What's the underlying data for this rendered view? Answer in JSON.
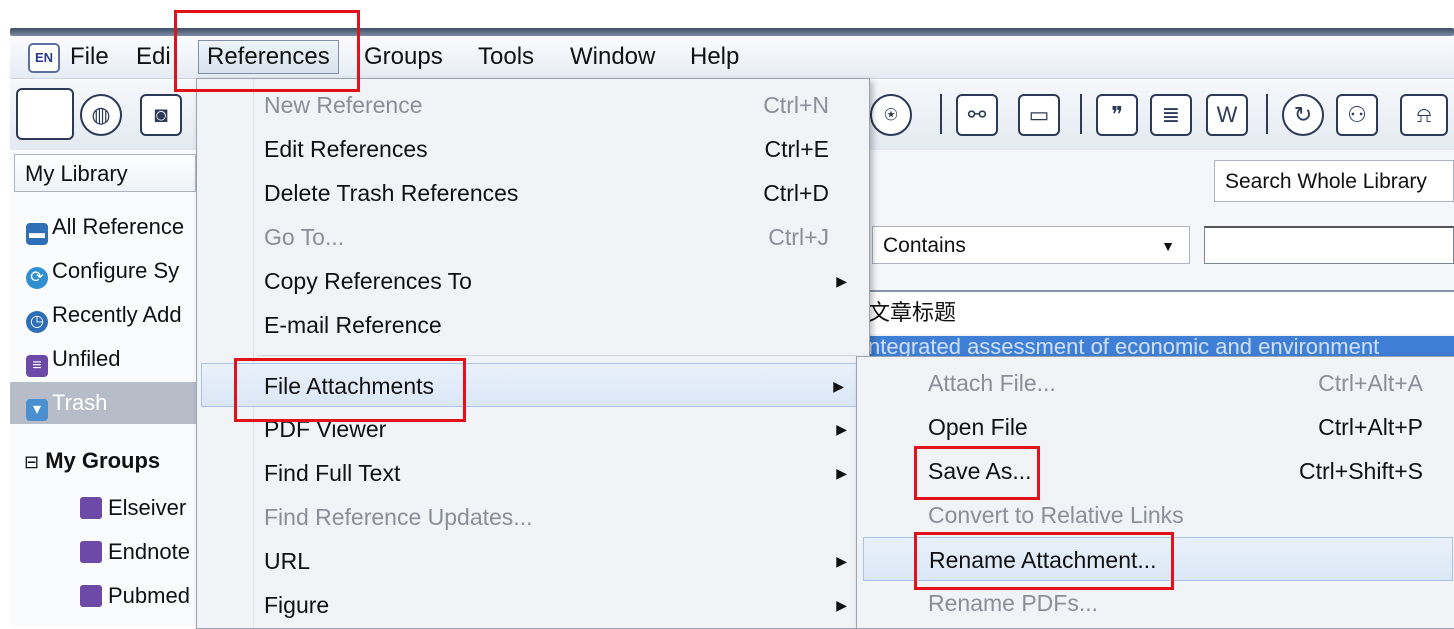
{
  "app_icon_label": "EN",
  "menubar": {
    "items": [
      "File",
      "Edi",
      "References",
      "Groups",
      "Tools",
      "Window",
      "Help"
    ]
  },
  "left_pane": {
    "library_dropdown": "My Library",
    "items": [
      {
        "label": "All Reference",
        "icon": "all-references-icon"
      },
      {
        "label": "Configure Sy",
        "icon": "sync-icon"
      },
      {
        "label": "Recently Add",
        "icon": "clock-icon"
      },
      {
        "label": "Unfiled",
        "icon": "unfiled-icon"
      },
      {
        "label": "Trash",
        "icon": "trash-icon"
      }
    ],
    "groups_toggle": "⊟",
    "groups_header": "My Groups",
    "groups": [
      "Elseiver",
      "Endnote",
      "Pubmed"
    ]
  },
  "right_pane": {
    "search_scope": "Search Whole Library",
    "contains_select": "Contains",
    "column_header": "文章标题",
    "selected_row_text": "ntegrated assessment of economic and environment"
  },
  "references_menu": {
    "items": [
      {
        "label": "New Reference",
        "shortcut": "Ctrl+N",
        "disabled": true
      },
      {
        "label": "Edit References",
        "shortcut": "Ctrl+E",
        "disabled": false
      },
      {
        "label": "Delete Trash References",
        "shortcut": "Ctrl+D",
        "disabled": false
      },
      {
        "label": "Go To...",
        "shortcut": "Ctrl+J",
        "disabled": true
      },
      {
        "label": "Copy References To",
        "submenu": true,
        "disabled": false
      },
      {
        "label": "E-mail Reference",
        "disabled": false
      },
      {
        "label": "File Attachments",
        "submenu": true,
        "disabled": false,
        "highlighted": true
      },
      {
        "label": "PDF Viewer",
        "submenu": true,
        "disabled": false
      },
      {
        "label": "Find Full Text",
        "submenu": true,
        "disabled": false
      },
      {
        "label": "Find Reference Updates...",
        "disabled": true
      },
      {
        "label": "URL",
        "submenu": true,
        "disabled": false
      },
      {
        "label": "Figure",
        "submenu": true,
        "disabled": false
      }
    ]
  },
  "file_attachments_submenu": {
    "items": [
      {
        "label": "Attach File...",
        "shortcut": "Ctrl+Alt+A",
        "disabled": true
      },
      {
        "label": "Open File",
        "shortcut": "Ctrl+Alt+P",
        "disabled": false
      },
      {
        "label": "Save As...",
        "shortcut": "Ctrl+Shift+S",
        "disabled": false
      },
      {
        "label": "Convert to Relative Links",
        "disabled": true
      },
      {
        "label": "Rename Attachment...",
        "disabled": false,
        "highlighted": true
      },
      {
        "label": "Rename PDFs...",
        "disabled": true
      }
    ]
  },
  "annotation_color": "#e2121a",
  "selection_color": "#3f7fd5"
}
